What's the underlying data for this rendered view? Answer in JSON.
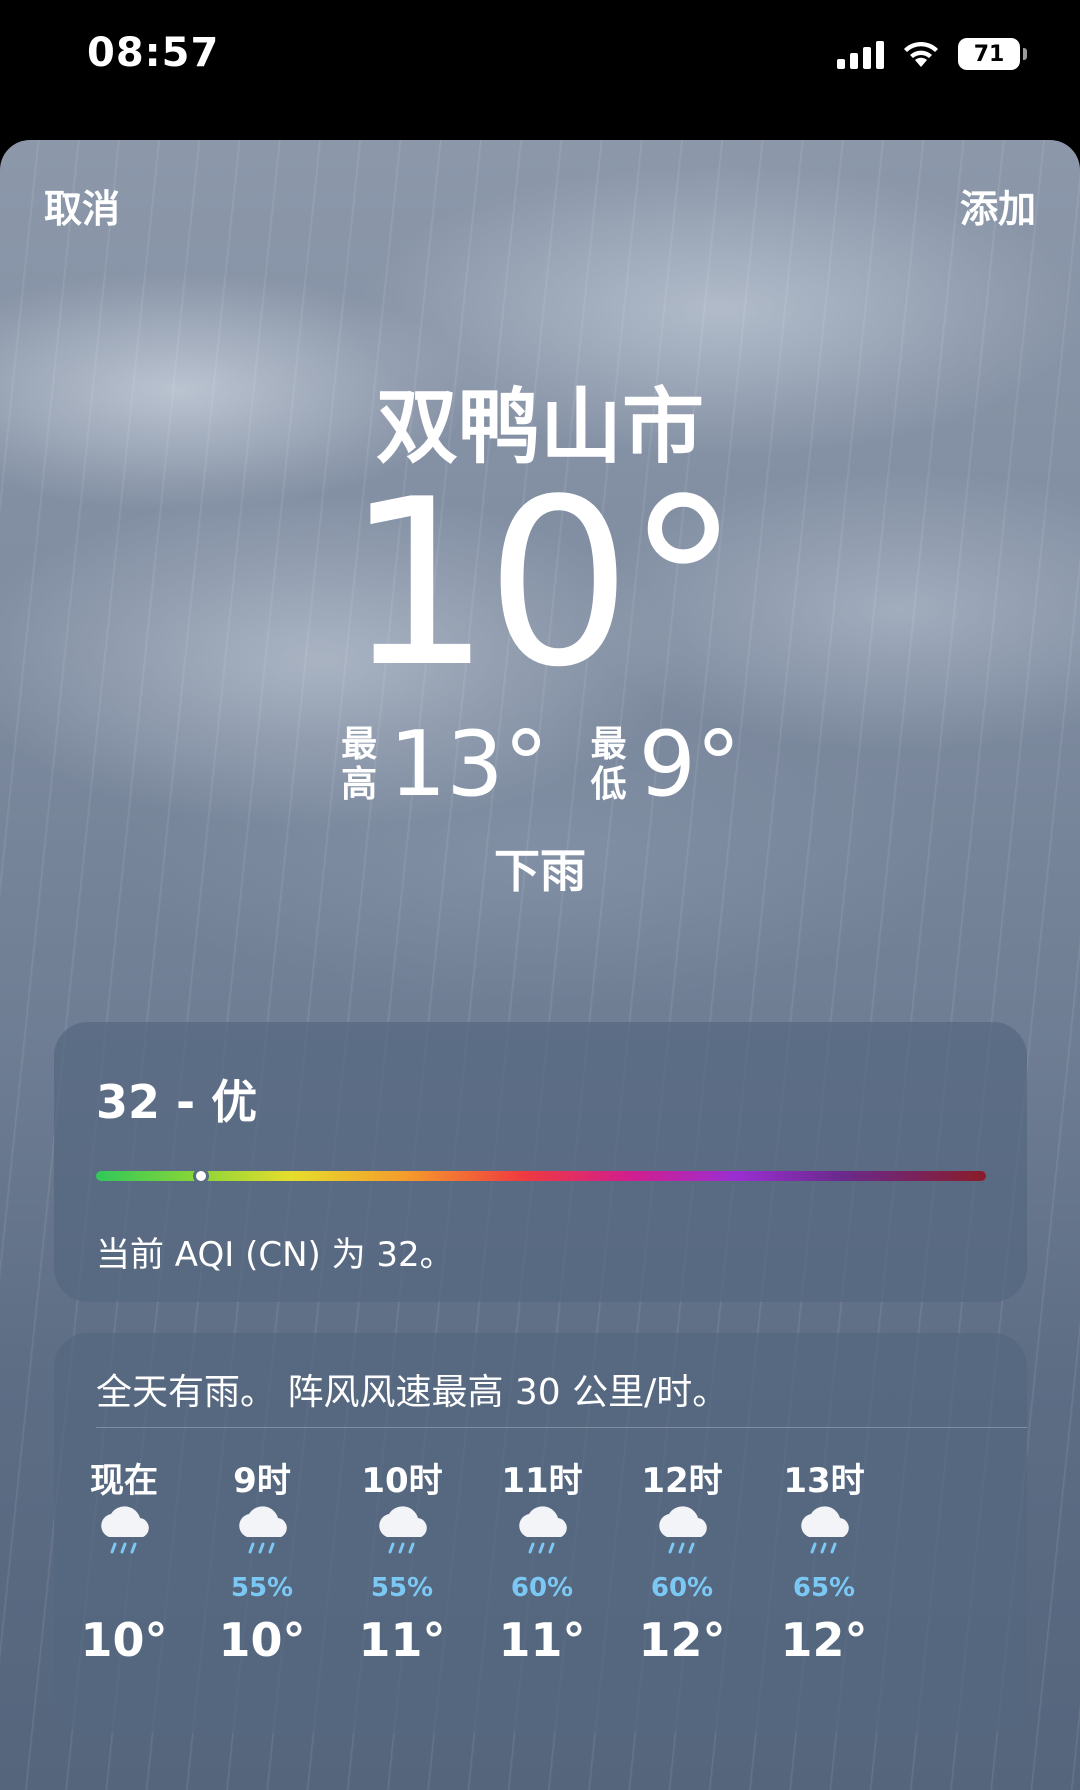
{
  "status_bar": {
    "time": "08:57",
    "battery": "71",
    "icons": [
      "signal-icon",
      "wifi-icon",
      "battery-icon"
    ]
  },
  "nav": {
    "cancel": "取消",
    "add": "添加"
  },
  "weather": {
    "city": "双鸭山市",
    "current_temp": "10°",
    "high_label": "最高",
    "high": "13°",
    "low_label": "最低",
    "low": "9°",
    "condition": "下雨"
  },
  "aqi": {
    "title": "32 - 优",
    "value": 32,
    "description": "当前 AQI (CN) 为 32。",
    "colors": [
      "#30c85a",
      "#e6dd2c",
      "#f59a2c",
      "#ef3a3f",
      "#d21e8e",
      "#9a2ed2",
      "#8a1c2a"
    ]
  },
  "forecast": {
    "summary": "全天有雨。 阵风风速最高 30 公里/时。",
    "hours": [
      {
        "label": "现在",
        "icon": "cloud-rain-icon",
        "pct": "",
        "temp": "10°"
      },
      {
        "label": "9时",
        "icon": "cloud-rain-icon",
        "pct": "55%",
        "temp": "10°"
      },
      {
        "label": "10时",
        "icon": "cloud-rain-icon",
        "pct": "55%",
        "temp": "11°"
      },
      {
        "label": "11时",
        "icon": "cloud-rain-icon",
        "pct": "60%",
        "temp": "11°"
      },
      {
        "label": "12时",
        "icon": "cloud-rain-icon",
        "pct": "60%",
        "temp": "12°"
      },
      {
        "label": "13时",
        "icon": "cloud-rain-icon",
        "pct": "65%",
        "temp": "12°"
      }
    ]
  }
}
